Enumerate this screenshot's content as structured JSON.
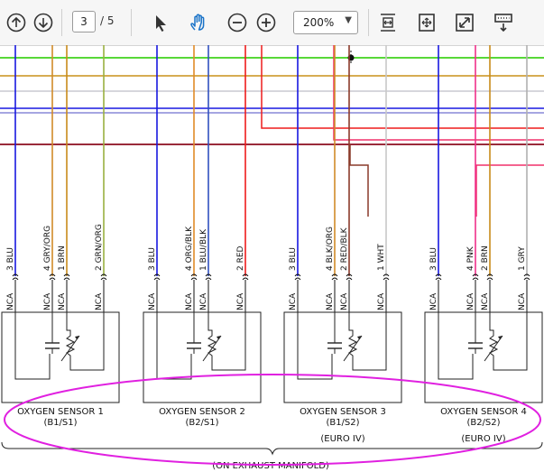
{
  "toolbar": {
    "page_current": "3",
    "page_total": "/ 5",
    "zoom": "200%",
    "icons": [
      "scroll-up-icon",
      "scroll-down-icon",
      "select-arrow-icon",
      "hand-tool-icon",
      "zoom-out-icon",
      "zoom-in-icon",
      "fit-width-icon",
      "fit-page-icon",
      "fullscreen-icon",
      "scroll-mode-icon"
    ]
  },
  "diagram": {
    "sensors": [
      {
        "name": "OXYGEN SENSOR 1",
        "sub": "(B1/S1)",
        "extra": "",
        "pins": [
          {
            "label": "NCA",
            "num": "3",
            "wire": "BLU",
            "color": "#1818e0"
          },
          {
            "label": "NCA",
            "num": "4",
            "wire": "GRY/ORG",
            "color": "#d08a28"
          },
          {
            "label": "NCA",
            "num": "1",
            "wire": "BRN",
            "color": "#c88a1a"
          },
          {
            "label": "NCA",
            "num": "2",
            "wire": "GRN/ORG",
            "color": "#9ab040"
          }
        ]
      },
      {
        "name": "OXYGEN SENSOR 2",
        "sub": "(B2/S1)",
        "extra": "",
        "pins": [
          {
            "label": "NCA",
            "num": "3",
            "wire": "BLU",
            "color": "#1818e0"
          },
          {
            "label": "NCA",
            "num": "4",
            "wire": "ORG/BLK",
            "color": "#e08a28"
          },
          {
            "label": "NCA",
            "num": "1",
            "wire": "BLU/BLK",
            "color": "#3050c0"
          },
          {
            "label": "NCA",
            "num": "2",
            "wire": "RED",
            "color": "#ee1c1c"
          }
        ]
      },
      {
        "name": "OXYGEN SENSOR 3",
        "sub": "(B1/S2)",
        "extra": "(EURO IV)",
        "pins": [
          {
            "label": "NCA",
            "num": "3",
            "wire": "BLU",
            "color": "#1818e0"
          },
          {
            "label": "NCA",
            "num": "4",
            "wire": "BLK/ORG",
            "color": "#d08a28"
          },
          {
            "label": "NCA",
            "num": "2",
            "wire": "RED/BLK",
            "color": "#8a3a2a"
          },
          {
            "label": "NCA",
            "num": "1",
            "wire": "WHT",
            "color": "#c8c8c8"
          }
        ]
      },
      {
        "name": "OXYGEN SENSOR 4",
        "sub": "(B2/S2)",
        "extra": "(EURO IV)",
        "pins": [
          {
            "label": "NCA",
            "num": "3",
            "wire": "BLU",
            "color": "#1818e0"
          },
          {
            "label": "NCA",
            "num": "4",
            "wire": "PNK",
            "color": "#f0308a"
          },
          {
            "label": "NCA",
            "num": "2",
            "wire": "BRN",
            "color": "#c88a1a"
          },
          {
            "label": "NCA",
            "num": "1",
            "wire": "GRY",
            "color": "#b0b0b0"
          }
        ]
      }
    ],
    "footer": "(ON EXHAUST MANIFOLD)",
    "highlight_color": "#e020e0"
  }
}
